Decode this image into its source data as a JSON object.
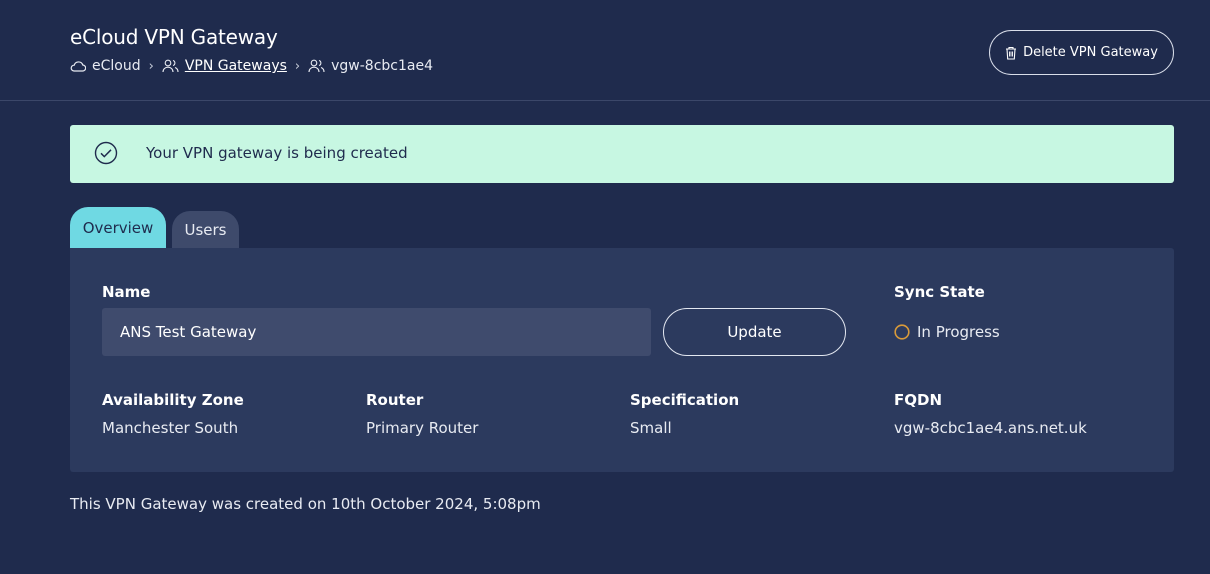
{
  "header": {
    "title": "eCloud VPN Gateway",
    "breadcrumb": {
      "root": "eCloud",
      "section": "VPN Gateways",
      "current": "vgw-8cbc1ae4"
    },
    "delete_label": "Delete VPN Gateway"
  },
  "alert": {
    "message": "Your VPN gateway is being created",
    "color": "#c7f7e2"
  },
  "tabs": [
    {
      "label": "Overview",
      "active": true
    },
    {
      "label": "Users",
      "active": false
    }
  ],
  "overview": {
    "name_label": "Name",
    "name_value": "ANS Test Gateway",
    "update_label": "Update",
    "sync_label": "Sync State",
    "sync_value": "In Progress",
    "sync_color": "#d99a3a",
    "az_label": "Availability Zone",
    "az_value": "Manchester South",
    "router_label": "Router",
    "router_value": "Primary Router",
    "spec_label": "Specification",
    "spec_value": "Small",
    "fqdn_label": "FQDN",
    "fqdn_value": "vgw-8cbc1ae4.ans.net.uk"
  },
  "footer": {
    "created_note": "This VPN Gateway was created on 10th October 2024, 5:08pm"
  },
  "colors": {
    "background": "#1f2b4d",
    "panel": "#2c3a5e",
    "accent_tab": "#6fd9e3"
  },
  "icons": {
    "breadcrumb_root": "cloud-icon",
    "breadcrumb_section": "users-icon",
    "breadcrumb_current": "users-icon",
    "delete": "trash-icon",
    "alert": "check-circle-icon",
    "sync": "progress-ring-icon"
  }
}
